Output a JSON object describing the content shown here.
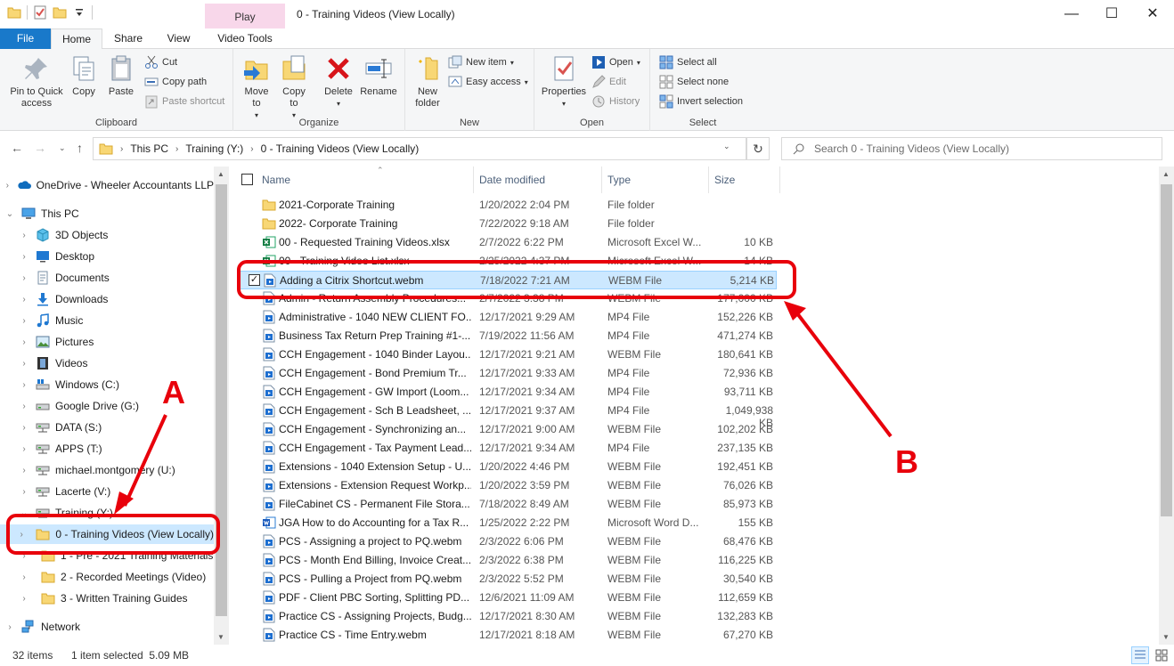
{
  "window": {
    "title": "0 - Training Videos (View Locally)",
    "context_tab": "Play",
    "minimize": "—",
    "maximize": "☐",
    "close": "✕"
  },
  "ribbon_tabs": {
    "file": "File",
    "home": "Home",
    "share": "Share",
    "view": "View",
    "video_tools": "Video Tools",
    "help": "?"
  },
  "ribbon": {
    "clipboard": {
      "label": "Clipboard",
      "pin": "Pin to Quick access",
      "copy": "Copy",
      "paste": "Paste",
      "cut": "Cut",
      "copy_path": "Copy path",
      "paste_shortcut": "Paste shortcut"
    },
    "organize": {
      "label": "Organize",
      "move_to": "Move to",
      "copy_to": "Copy to",
      "delete": "Delete",
      "rename": "Rename"
    },
    "new": {
      "label": "New",
      "new_folder": "New folder",
      "new_item": "New item",
      "easy_access": "Easy access"
    },
    "open": {
      "label": "Open",
      "properties": "Properties",
      "open": "Open",
      "edit": "Edit",
      "history": "History"
    },
    "select": {
      "label": "Select",
      "select_all": "Select all",
      "select_none": "Select none",
      "invert": "Invert selection"
    }
  },
  "address": {
    "crumbs": [
      "This PC",
      "Training (Y:)",
      "0 - Training Videos (View Locally)"
    ],
    "search_placeholder": "Search 0 - Training Videos (View Locally)"
  },
  "tree": [
    {
      "label": "OneDrive - Wheeler Accountants LLP",
      "icon": "cloud-icon",
      "indent": 0,
      "expander": "›"
    },
    {
      "label": "This PC",
      "icon": "computer-icon",
      "indent": 0,
      "expander": "⌄"
    },
    {
      "label": "3D Objects",
      "icon": "cube-icon",
      "indent": 1,
      "expander": "›"
    },
    {
      "label": "Desktop",
      "icon": "desktop-icon",
      "indent": 1,
      "expander": "›"
    },
    {
      "label": "Documents",
      "icon": "documents-icon",
      "indent": 1,
      "expander": "›"
    },
    {
      "label": "Downloads",
      "icon": "download-icon",
      "indent": 1,
      "expander": "›"
    },
    {
      "label": "Music",
      "icon": "music-icon",
      "indent": 1,
      "expander": "›"
    },
    {
      "label": "Pictures",
      "icon": "pictures-icon",
      "indent": 1,
      "expander": "›"
    },
    {
      "label": "Videos",
      "icon": "videos-icon",
      "indent": 1,
      "expander": "›"
    },
    {
      "label": "Windows (C:)",
      "icon": "windows-drive-icon",
      "indent": 1,
      "expander": "›"
    },
    {
      "label": "Google Drive (G:)",
      "icon": "drive-icon",
      "indent": 1,
      "expander": "›"
    },
    {
      "label": "DATA (S:)",
      "icon": "network-drive-icon",
      "indent": 1,
      "expander": "›"
    },
    {
      "label": "APPS (T:)",
      "icon": "network-drive-icon",
      "indent": 1,
      "expander": "›"
    },
    {
      "label": "michael.montgomery (U:)",
      "icon": "network-drive-icon",
      "indent": 1,
      "expander": "›"
    },
    {
      "label": "Lacerte (V:)",
      "icon": "network-drive-icon",
      "indent": 1,
      "expander": "›"
    },
    {
      "label": "Training (Y:)",
      "icon": "network-drive-icon",
      "indent": 1,
      "expander": "⌄"
    },
    {
      "label": "0 - Training Videos (View Locally)",
      "icon": "folder-icon",
      "indent": 2,
      "expander": "›",
      "selected": true
    },
    {
      "label": "1 - Pre - 2021 Training Materials",
      "icon": "folder-icon",
      "indent": 2,
      "expander": "›"
    },
    {
      "label": "2 - Recorded Meetings (Video)",
      "icon": "folder-icon",
      "indent": 2,
      "expander": "›"
    },
    {
      "label": "3 - Written Training Guides",
      "icon": "folder-icon",
      "indent": 2,
      "expander": "›"
    },
    {
      "label": "Network",
      "icon": "network-icon",
      "indent": 0,
      "expander": "›"
    }
  ],
  "columns": {
    "name": "Name",
    "date": "Date modified",
    "type": "Type",
    "size": "Size"
  },
  "files": [
    {
      "name": "2021-Corporate Training",
      "date": "1/20/2022 2:04 PM",
      "type": "File folder",
      "size": "",
      "icon": "folder-icon"
    },
    {
      "name": "2022- Corporate Training",
      "date": "7/22/2022 9:18 AM",
      "type": "File folder",
      "size": "",
      "icon": "folder-icon"
    },
    {
      "name": "00 - Requested Training Videos.xlsx",
      "date": "2/7/2022 6:22 PM",
      "type": "Microsoft Excel W...",
      "size": "10 KB",
      "icon": "excel-icon"
    },
    {
      "name": "00 - Training Video List.xlsx",
      "date": "2/25/2022 4:37 PM",
      "type": "Microsoft Excel W...",
      "size": "14 KB",
      "icon": "excel-icon"
    },
    {
      "name": "Adding a Citrix Shortcut.webm",
      "date": "7/18/2022 7:21 AM",
      "type": "WEBM File",
      "size": "5,214 KB",
      "icon": "video-file-icon",
      "selected": true
    },
    {
      "name": "Admin - Return Assembly Procedures...",
      "date": "2/7/2022 3:38 PM",
      "type": "WEBM File",
      "size": "177,000 KB",
      "icon": "video-file-icon"
    },
    {
      "name": "Administrative - 1040 NEW CLIENT FO...",
      "date": "12/17/2021 9:29 AM",
      "type": "MP4 File",
      "size": "152,226 KB",
      "icon": "video-file-icon"
    },
    {
      "name": "Business Tax Return Prep Training #1-...",
      "date": "7/19/2022 11:56 AM",
      "type": "MP4 File",
      "size": "471,274 KB",
      "icon": "video-file-icon"
    },
    {
      "name": "CCH Engagement - 1040 Binder Layou...",
      "date": "12/17/2021 9:21 AM",
      "type": "WEBM File",
      "size": "180,641 KB",
      "icon": "video-file-icon"
    },
    {
      "name": "CCH Engagement - Bond Premium Tr...",
      "date": "12/17/2021 9:33 AM",
      "type": "MP4 File",
      "size": "72,936 KB",
      "icon": "video-file-icon"
    },
    {
      "name": "CCH Engagement - GW Import (Loom...",
      "date": "12/17/2021 9:34 AM",
      "type": "MP4 File",
      "size": "93,711 KB",
      "icon": "video-file-icon"
    },
    {
      "name": "CCH Engagement - Sch B Leadsheet, ...",
      "date": "12/17/2021 9:37 AM",
      "type": "MP4 File",
      "size": "1,049,938 KB",
      "icon": "video-file-icon"
    },
    {
      "name": "CCH Engagement - Synchronizing an...",
      "date": "12/17/2021 9:00 AM",
      "type": "WEBM File",
      "size": "102,202 KB",
      "icon": "video-file-icon"
    },
    {
      "name": "CCH Engagement - Tax Payment Lead...",
      "date": "12/17/2021 9:34 AM",
      "type": "MP4 File",
      "size": "237,135 KB",
      "icon": "video-file-icon"
    },
    {
      "name": "Extensions - 1040 Extension Setup - U...",
      "date": "1/20/2022 4:46 PM",
      "type": "WEBM File",
      "size": "192,451 KB",
      "icon": "video-file-icon"
    },
    {
      "name": "Extensions - Extension Request Workp...",
      "date": "1/20/2022 3:59 PM",
      "type": "WEBM File",
      "size": "76,026 KB",
      "icon": "video-file-icon"
    },
    {
      "name": "FileCabinet CS - Permanent File Stora...",
      "date": "7/18/2022 8:49 AM",
      "type": "WEBM File",
      "size": "85,973 KB",
      "icon": "video-file-icon"
    },
    {
      "name": "JGA How to do Accounting for a Tax R...",
      "date": "1/25/2022 2:22 PM",
      "type": "Microsoft Word D...",
      "size": "155 KB",
      "icon": "word-icon"
    },
    {
      "name": "PCS - Assigning a project to PQ.webm",
      "date": "2/3/2022 6:06 PM",
      "type": "WEBM File",
      "size": "68,476 KB",
      "icon": "video-file-icon"
    },
    {
      "name": "PCS - Month End Billing, Invoice Creat...",
      "date": "2/3/2022 6:38 PM",
      "type": "WEBM File",
      "size": "116,225 KB",
      "icon": "video-file-icon"
    },
    {
      "name": "PCS - Pulling a Project from PQ.webm",
      "date": "2/3/2022 5:52 PM",
      "type": "WEBM File",
      "size": "30,540 KB",
      "icon": "video-file-icon"
    },
    {
      "name": "PDF - Client PBC Sorting, Splitting PD...",
      "date": "12/6/2021 11:09 AM",
      "type": "WEBM File",
      "size": "112,659 KB",
      "icon": "video-file-icon"
    },
    {
      "name": "Practice CS - Assigning Projects, Budg...",
      "date": "12/17/2021 8:30 AM",
      "type": "WEBM File",
      "size": "132,283 KB",
      "icon": "video-file-icon"
    },
    {
      "name": "Practice CS - Time Entry.webm",
      "date": "12/17/2021 8:18 AM",
      "type": "WEBM File",
      "size": "67,270 KB",
      "icon": "video-file-icon"
    }
  ],
  "status": {
    "items": "32 items",
    "selection": "1 item selected  5.09 MB"
  },
  "annotations": {
    "a": "A",
    "b": "B",
    "color": "#e8000b"
  }
}
